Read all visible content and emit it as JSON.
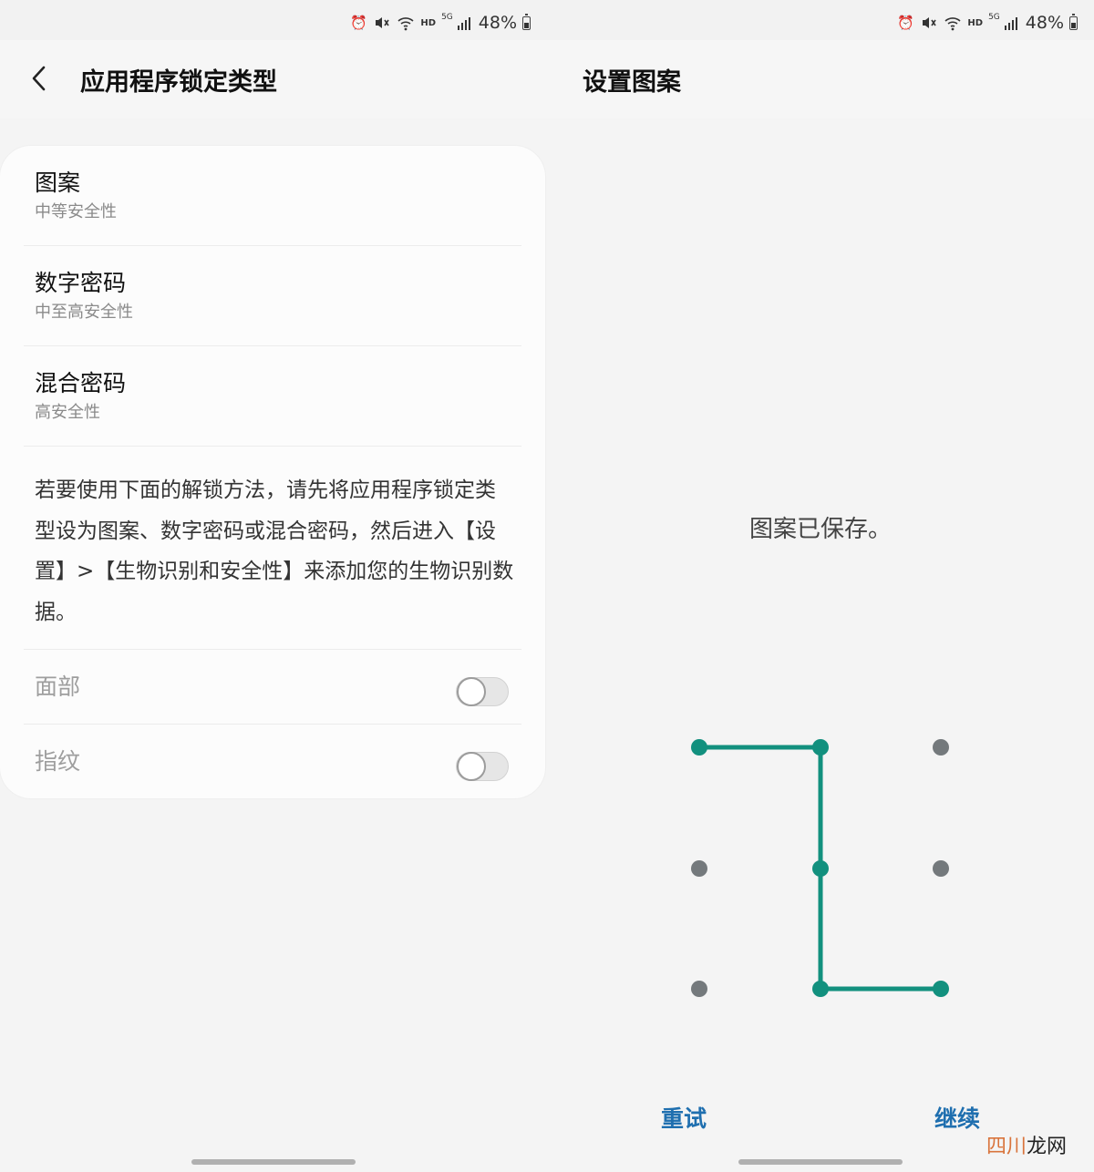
{
  "left": {
    "status": {
      "battery": "48%",
      "network": "5G",
      "hd": "HD"
    },
    "header": {
      "title": "应用程序锁定类型"
    },
    "options": [
      {
        "title": "图案",
        "subtitle": "中等安全性"
      },
      {
        "title": "数字密码",
        "subtitle": "中至高安全性"
      },
      {
        "title": "混合密码",
        "subtitle": "高安全性"
      }
    ],
    "description": "若要使用下面的解锁方法，请先将应用程序锁定类型设为图案、数字密码或混合密码，然后进入【设置】>【生物识别和安全性】来添加您的生物识别数据。",
    "toggles": [
      {
        "label": "面部",
        "on": false
      },
      {
        "label": "指纹",
        "on": false
      }
    ]
  },
  "right": {
    "status": {
      "battery": "48%",
      "network": "5G",
      "hd": "HD"
    },
    "header": {
      "title": "设置图案"
    },
    "message": "图案已保存。",
    "pattern": {
      "grid": "3x3",
      "sequence": [
        1,
        2,
        5,
        8,
        9
      ],
      "active_dots": [
        1,
        2,
        5,
        8,
        9
      ],
      "active_color": "#12907e",
      "inactive_color": "#74797c"
    },
    "buttons": {
      "retry": "重试",
      "continue": "继续"
    }
  },
  "watermark": {
    "part1": "四川",
    "part2": "龙网"
  },
  "colors": {
    "accent": "#1f6faf",
    "pattern": "#12907e"
  }
}
